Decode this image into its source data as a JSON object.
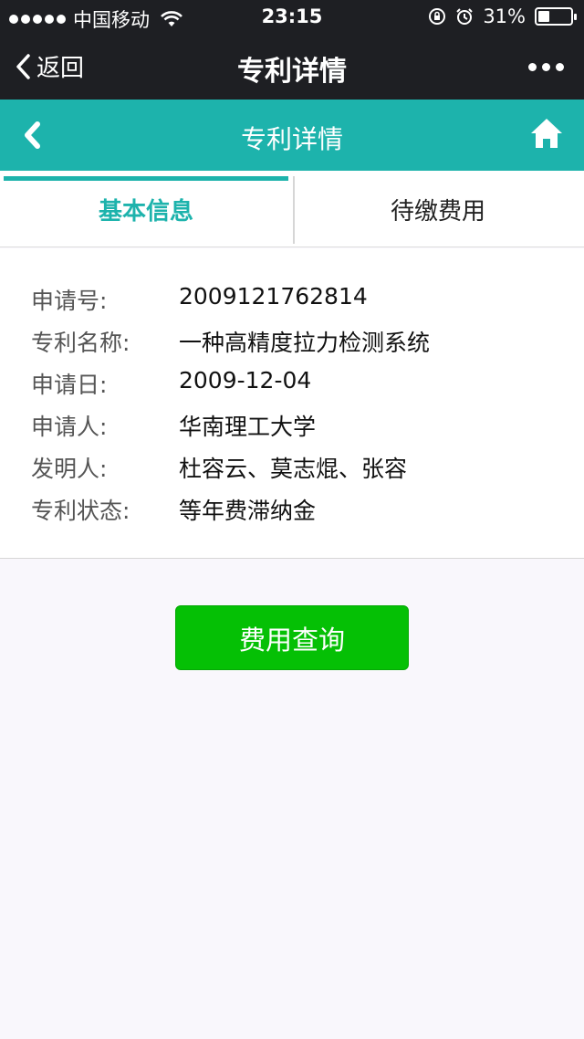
{
  "status_bar": {
    "carrier": "中国移动",
    "time": "23:15",
    "battery_percent": "31%",
    "battery_level": 0.31,
    "icons": [
      "signal-dots-icon",
      "wifi-icon",
      "rotation-lock-icon",
      "alarm-icon",
      "battery-icon"
    ]
  },
  "wechat_nav": {
    "back_label": "返回",
    "title": "专利详情",
    "more_icon": "more-dots-icon"
  },
  "header": {
    "title": "专利详情",
    "back_icon": "chevron-left-icon",
    "home_icon": "home-icon",
    "color": "#1db3ac"
  },
  "tabs": [
    {
      "label": "基本信息",
      "active": true
    },
    {
      "label": "待缴费用",
      "active": false
    }
  ],
  "info": {
    "rows": [
      {
        "label": "申请号:",
        "value": "2009121762814"
      },
      {
        "label": "专利名称:",
        "value": "一种高精度拉力检测系统"
      },
      {
        "label": "申请日:",
        "value": "2009-12-04"
      },
      {
        "label": "申请人:",
        "value": "华南理工大学"
      },
      {
        "label": "发明人:",
        "value": "杜容云、莫志焜、张容"
      },
      {
        "label": "专利状态:",
        "value": "等年费滞纳金"
      }
    ]
  },
  "actions": {
    "query_button": "费用查询",
    "button_color": "#05c005"
  }
}
